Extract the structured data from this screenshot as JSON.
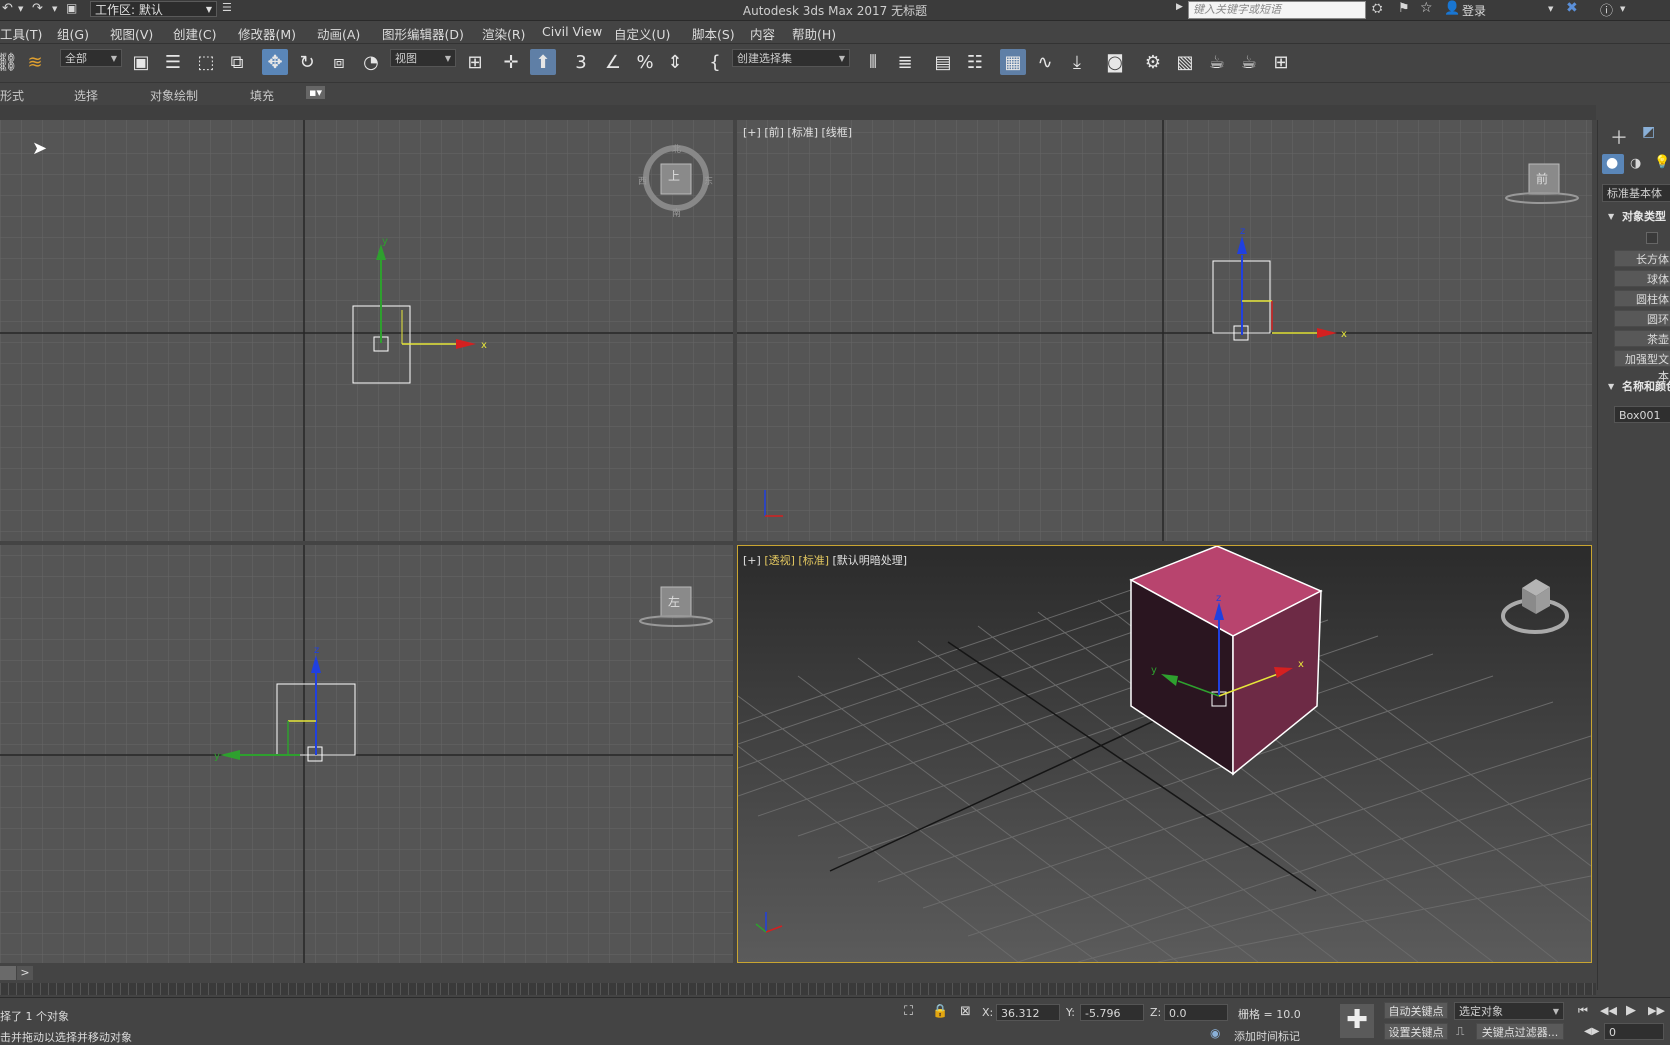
{
  "titlebar": {
    "title": "Autodesk 3ds Max 2017     无标题",
    "workspace_label": "工作区: 默认",
    "search_placeholder": "键入关键字或短语",
    "login_label": "登录"
  },
  "menu": {
    "items": [
      "工具(T)",
      "组(G)",
      "视图(V)",
      "创建(C)",
      "修改器(M)",
      "动画(A)",
      "图形编辑器(D)",
      "渲染(R)",
      "Civil View",
      "自定义(U)",
      "脚本(S)",
      "内容",
      "帮助(H)"
    ]
  },
  "toolbar": {
    "filter_value": "全部",
    "refcoord_value": "视图",
    "selection_set_value": "创建选择集"
  },
  "ribbon": {
    "tabs": [
      "形式",
      "选择",
      "对象绘制",
      "填充"
    ]
  },
  "viewports": {
    "top": {
      "cube_label": "上",
      "compass": {
        "n": "北",
        "s": "南",
        "e": "东",
        "w": "西"
      }
    },
    "front": {
      "label_plus": "[+]",
      "label_view": "[前]",
      "label_shading": "[标准]",
      "label_mode": "[线框]",
      "cube_label": "前"
    },
    "left": {
      "cube_label": "左"
    },
    "perspective": {
      "label_plus": "[+]",
      "label_view": "[透视]",
      "label_shading": "[标准]",
      "label_mode": "[默认明暗处理]"
    }
  },
  "command_panel": {
    "category_value": "标准基本体",
    "rollout_object_type": "对象类型",
    "object_buttons": [
      "长方体",
      "球体",
      "圆柱体",
      "圆环",
      "茶壶",
      "加强型文本"
    ],
    "rollout_name_color": "名称和颜色",
    "object_name": "Box001"
  },
  "timeline": {
    "next_label": ">"
  },
  "status": {
    "selected_text": "择了 1 个对象",
    "prompt_text": "击并拖动以选择并移动对象",
    "x_label": "X:",
    "x_value": "36.312",
    "y_label": "Y:",
    "y_value": "-5.796",
    "z_label": "Z:",
    "z_value": "0.0",
    "grid_text": "栅格 = 10.0",
    "add_time_tag": "添加时间标记",
    "auto_key": "自动关键点",
    "set_key": "设置关键点",
    "selected_object": "选定对象",
    "key_filters": "关键点过滤器...",
    "frame_value": "0"
  },
  "colors": {
    "viewport_bg": "#555555",
    "box_color": "#b8446e",
    "active_border": "#c9a531",
    "x_axis": "#d42020",
    "y_axis": "#20a020",
    "z_axis": "#2040e0"
  }
}
